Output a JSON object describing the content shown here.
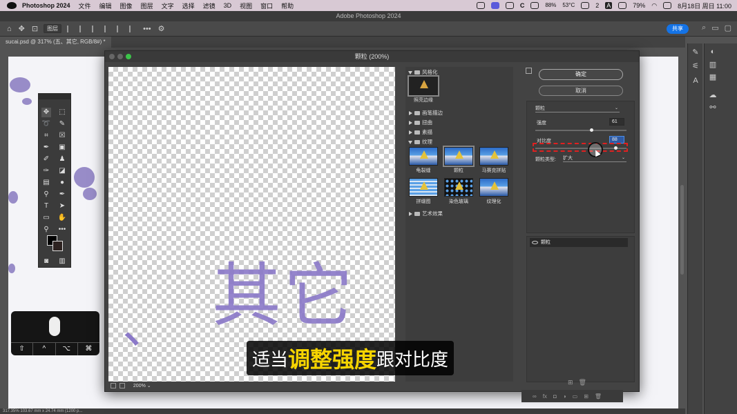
{
  "menubar": {
    "app_name": "Photoshop 2024",
    "items": [
      "文件",
      "编辑",
      "图像",
      "图层",
      "文字",
      "选择",
      "滤镜",
      "3D",
      "视图",
      "窗口",
      "帮助"
    ],
    "status": {
      "battery_pct": "88%",
      "cpu_temp": "53°C",
      "wechat_count": "2",
      "input_method": "A",
      "volume_pct": "79%",
      "datetime": "8月18日 周日 11:00"
    }
  },
  "window_title": "Adobe Photoshop 2024",
  "options_bar": {
    "layer_select": "图层",
    "share_label": "共享"
  },
  "document_tab": "sucai.psd @ 317% (五、其它, RGB/8#) *",
  "status_bar": "317.35%   103.67 mm x 24.74 mm (1200 p...",
  "dialog": {
    "title": "颗粒 (200%)",
    "ok_label": "确定",
    "cancel_label": "取消",
    "zoom_level": "200%",
    "preview_text": "其它",
    "preview_mark": "、",
    "gallery": {
      "categories": [
        {
          "name": "风格化",
          "open": true
        },
        {
          "name": "画笔描边",
          "open": false
        },
        {
          "name": "扭曲",
          "open": false
        },
        {
          "name": "素描",
          "open": false
        },
        {
          "name": "纹理",
          "open": true
        },
        {
          "name": "艺术效果",
          "open": false
        }
      ],
      "stylize_filters": [
        "照亮边缘"
      ],
      "texture_filters": [
        "龟裂缝",
        "颗粒",
        "马赛克拼贴",
        "拼缀图",
        "染色玻璃",
        "纹理化"
      ],
      "selected_filter": "颗粒"
    },
    "settings": {
      "filter_select": "颗粒",
      "intensity_label": "强度",
      "intensity_value": "61",
      "intensity_fraction": 0.61,
      "contrast_label": "对比度",
      "contrast_value": "88",
      "contrast_fraction": 0.88,
      "grain_type_label": "颗粒类型:",
      "grain_type_value": "扩大"
    },
    "layers": [
      "颗粒"
    ]
  },
  "subtitle": {
    "pre": "适当",
    "highlight": "调整强度",
    "post": "跟对比度"
  },
  "keystroke_overlay": {
    "keys": [
      "⇧",
      "^",
      "⌥",
      "⌘"
    ]
  },
  "colors": {
    "accent": "#1473e6",
    "highlight_box": "#e02020",
    "subtitle_yellow": "#f6d400",
    "menubar_bg": "#d8c9d4"
  }
}
